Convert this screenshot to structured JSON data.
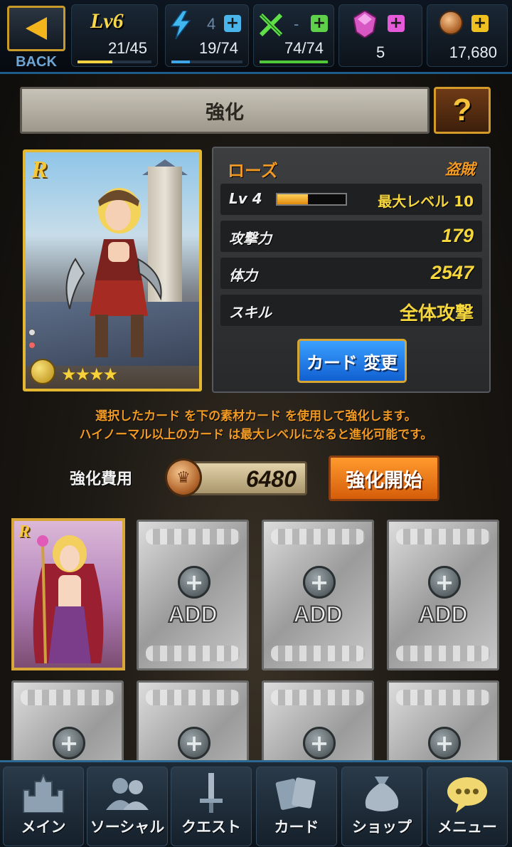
{
  "topbar": {
    "back_label": "BACK",
    "level_label": "Lv6",
    "exp_value": "21/45",
    "exp_fraction": 0.47,
    "stamina_plus_count": "4",
    "stamina_value": "19/74",
    "stamina_fraction": 0.26,
    "battle_plus_count": "-",
    "battle_value": "74/74",
    "battle_fraction": 1.0,
    "gems_value": "5",
    "coins_value": "17,680"
  },
  "screen": {
    "title": "強化",
    "help_label": "?"
  },
  "card": {
    "rarity": "R",
    "stars": "★★★★",
    "name": "ローズ",
    "class": "盗賊",
    "level_label": "Lv 4",
    "level_fraction": 0.45,
    "max_level_label": "最大レベル 10",
    "attack_label": "攻撃力",
    "attack_value": "179",
    "hp_label": "体力",
    "hp_value": "2547",
    "skill_label": "スキル",
    "skill_value": "全体攻撃",
    "change_button": "カード 変更"
  },
  "description": {
    "line1": "選択したカード を下の素材カード を使用して強化します。",
    "line2": "ハイノーマル以上のカード は最大レベルになると進化可能です。"
  },
  "enhance": {
    "cost_label": "強化費用",
    "cost_value": "6480",
    "start_button": "強化開始"
  },
  "materials": {
    "card_rarity": "R",
    "add_label": "ADD"
  },
  "nav": {
    "items": [
      {
        "label": "メイン"
      },
      {
        "label": "ソーシャル"
      },
      {
        "label": "クエスト"
      },
      {
        "label": "カード"
      },
      {
        "label": "ショップ"
      },
      {
        "label": "メニュー"
      }
    ]
  },
  "colors": {
    "accent_orange": "#f39a23",
    "value_yellow": "#f6d63d",
    "button_blue": "#1160d1",
    "button_orange": "#d55d0a"
  }
}
